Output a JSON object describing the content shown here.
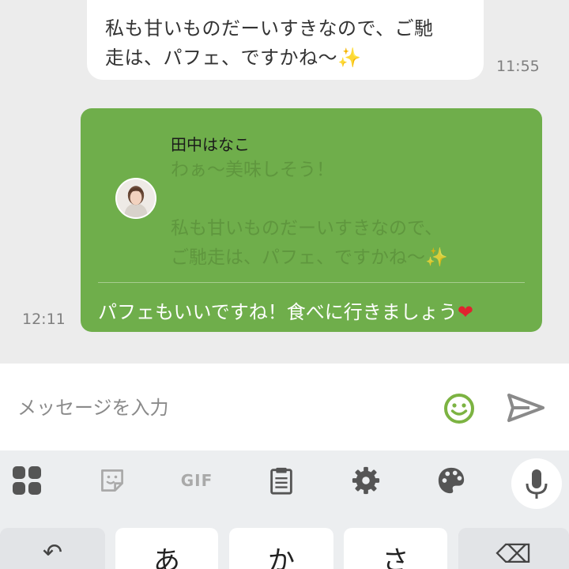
{
  "chat": {
    "incoming_message": {
      "text": "私も甘いものだーいすきなので、ご馳\n走は、パフェ、ですかね〜✨",
      "time": "11:55"
    },
    "outgoing_message": {
      "quote_name": "田中はなこ",
      "quote_text": "わぁ〜美味しそう！\n\n私も甘いものだーいすきなので、\nご馳走は、パフェ、ですかね〜✨",
      "reply_text": "パフェもいいですね！食べに行きましょう",
      "reply_emoji": "❤",
      "time": "12:11"
    }
  },
  "input_bar": {
    "placeholder": "メッセージを入力",
    "emoji_icon": "smiley-icon",
    "send_icon": "send-icon"
  },
  "keyboard": {
    "toolbar": [
      "apps-grid-icon",
      "sticker-icon",
      "GIF",
      "clipboard-icon",
      "gear-icon",
      "palette-icon",
      "mic-icon"
    ],
    "gif_label": "GIF",
    "keys": {
      "undo": "↶",
      "a": "あ",
      "ka": "か",
      "sa": "さ",
      "backspace": "⌫"
    }
  },
  "colors": {
    "bubble_green": "#6fae4b",
    "emoji_green": "#7cb342",
    "heart_red": "#e0242f"
  }
}
